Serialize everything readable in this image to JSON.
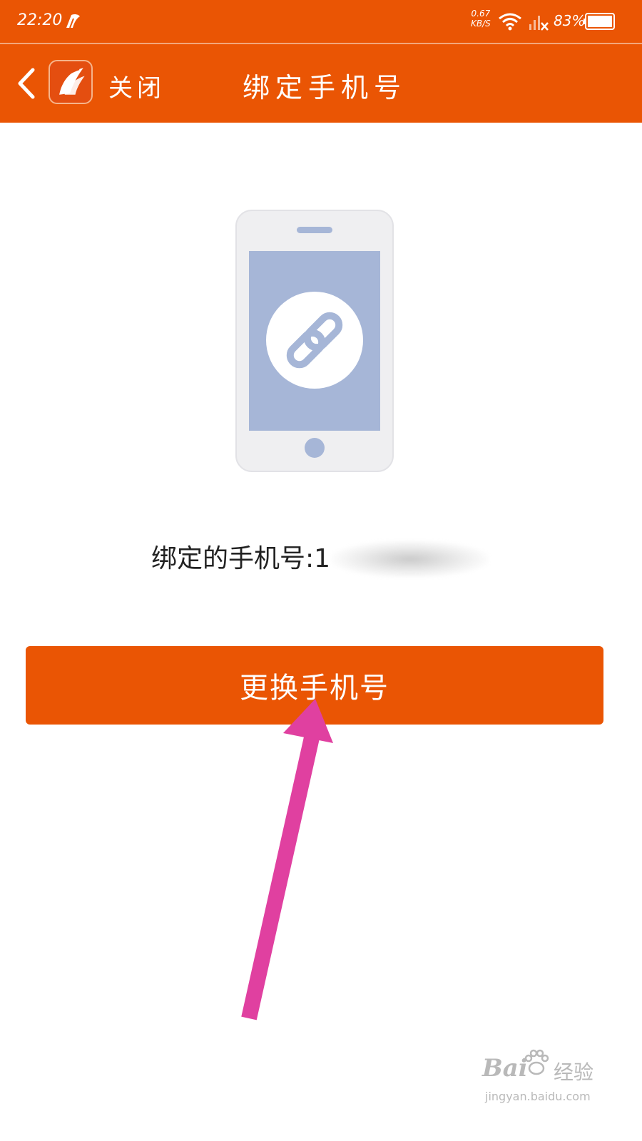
{
  "status_bar": {
    "time": "22:20",
    "net_speed_value": "0.67",
    "net_speed_unit": "KB/S",
    "battery_percent": "83%",
    "icons": [
      "app-notification-icon",
      "wifi-icon",
      "signal-icon",
      "battery-icon"
    ]
  },
  "nav": {
    "back_icon": "chevron-left-icon",
    "logo_icon": "app-logo",
    "close_label": "关闭",
    "title": "绑定手机号"
  },
  "main": {
    "illustration_icon": "phone-link-icon",
    "bound_label": "绑定的手机号:",
    "bound_number": "1",
    "change_button_label": "更换手机号"
  },
  "annotation": {
    "arrow_color": "#e040a0"
  },
  "watermark": {
    "brand": "Bai",
    "brand_suffix": "经验",
    "url": "jingyan.baidu.com"
  },
  "colors": {
    "accent": "#ea5504",
    "illustration_body": "#efeff1",
    "illustration_screen": "#a6b6d7",
    "text": "#222222"
  }
}
